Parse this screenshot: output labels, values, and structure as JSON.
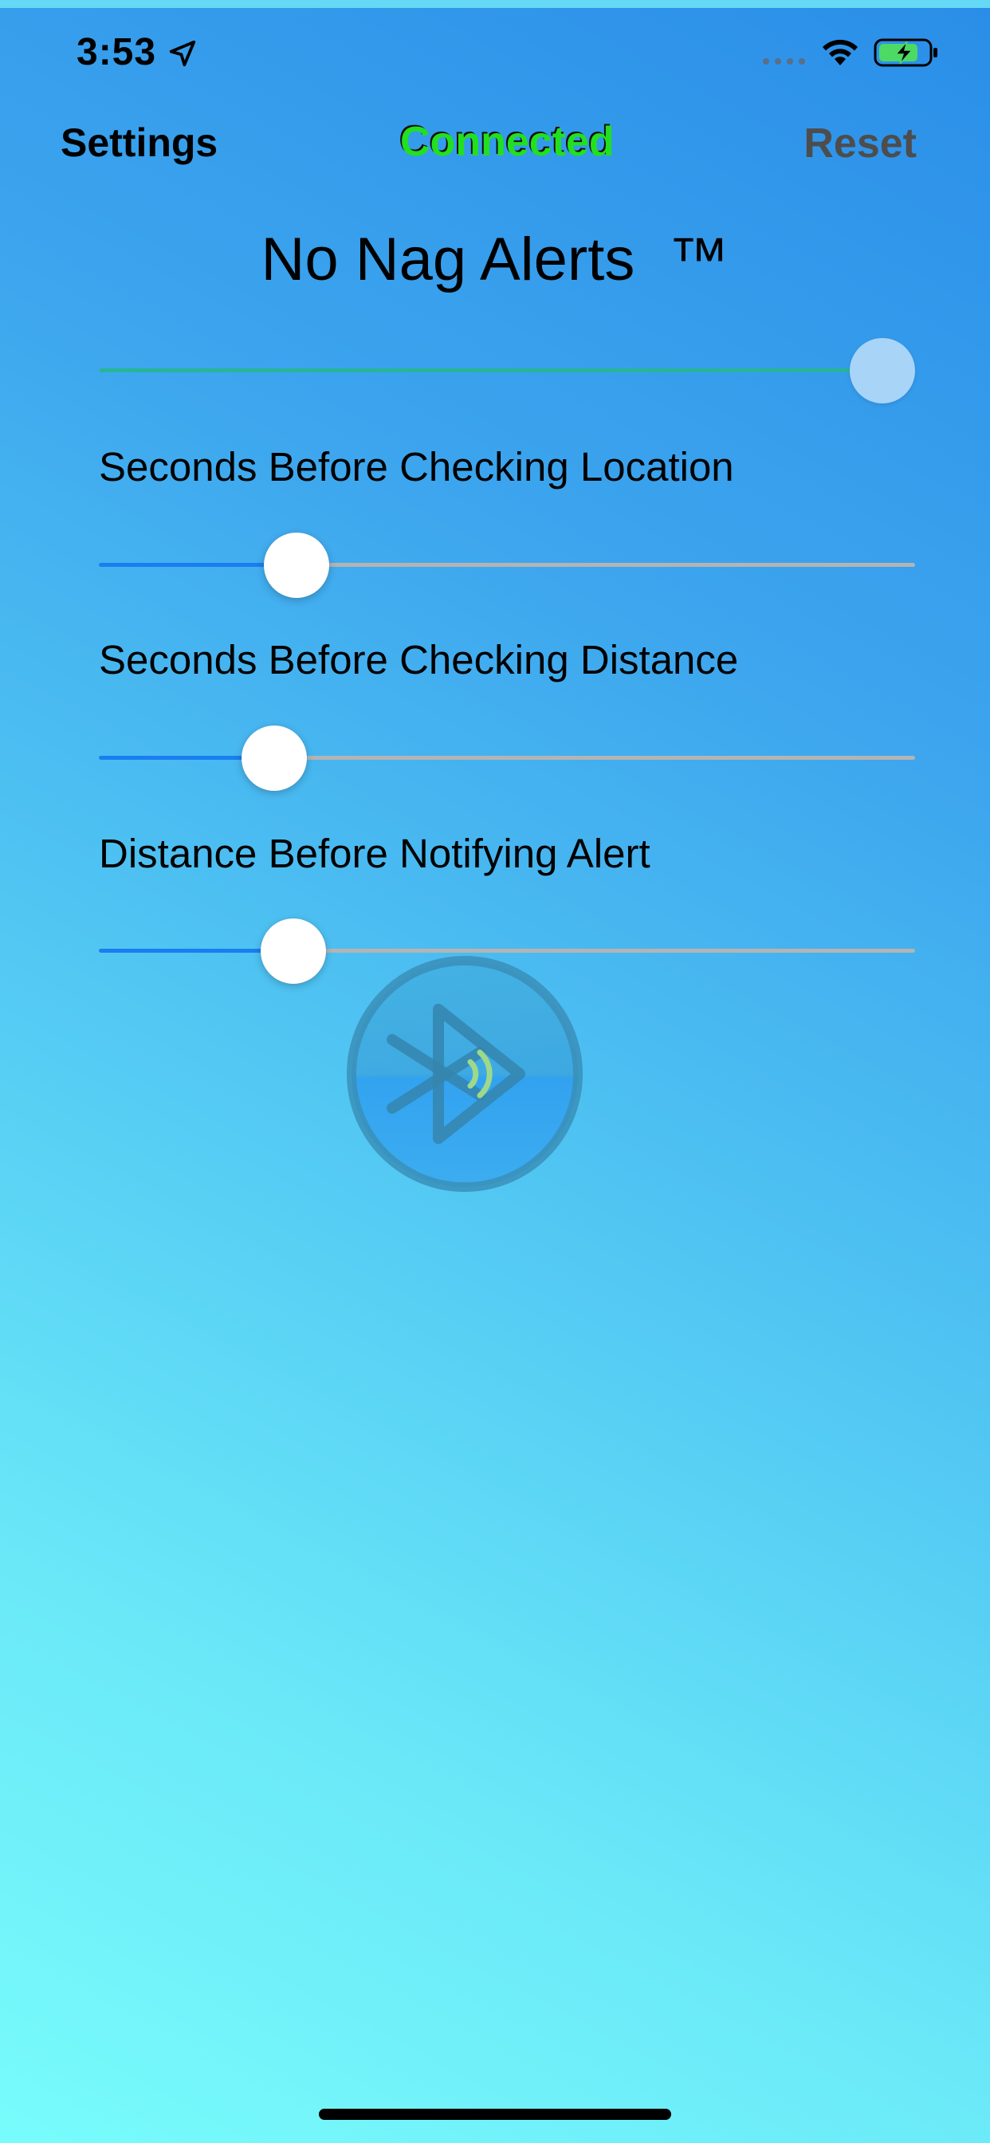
{
  "status_bar": {
    "time": "3:53",
    "icons": [
      "location-arrow-icon",
      "signal-dots-icon",
      "wifi-icon",
      "battery-charging-icon"
    ],
    "battery_color": "#4cd964"
  },
  "nav": {
    "left_label": "Settings",
    "center_label": "Connected",
    "center_overlay_label": "Connected",
    "center_overlay_color": "#22e01e",
    "right_label": "Reset"
  },
  "title": "No Nag Alerts  ™",
  "master_slider": {
    "value": 1.0,
    "accent": "#27b59a"
  },
  "sliders": [
    {
      "label": "Seconds Before Checking Location",
      "value": 0.22
    },
    {
      "label": "Seconds Before Checking Distance",
      "value": 0.19
    },
    {
      "label": "Distance Before Notifying Alert",
      "value": 0.215
    }
  ],
  "colors": {
    "slider_fill": "#1a7ef0",
    "slider_track": "#b4b4b4"
  },
  "logo": {
    "icon": "bluetooth-broadcast-icon"
  }
}
